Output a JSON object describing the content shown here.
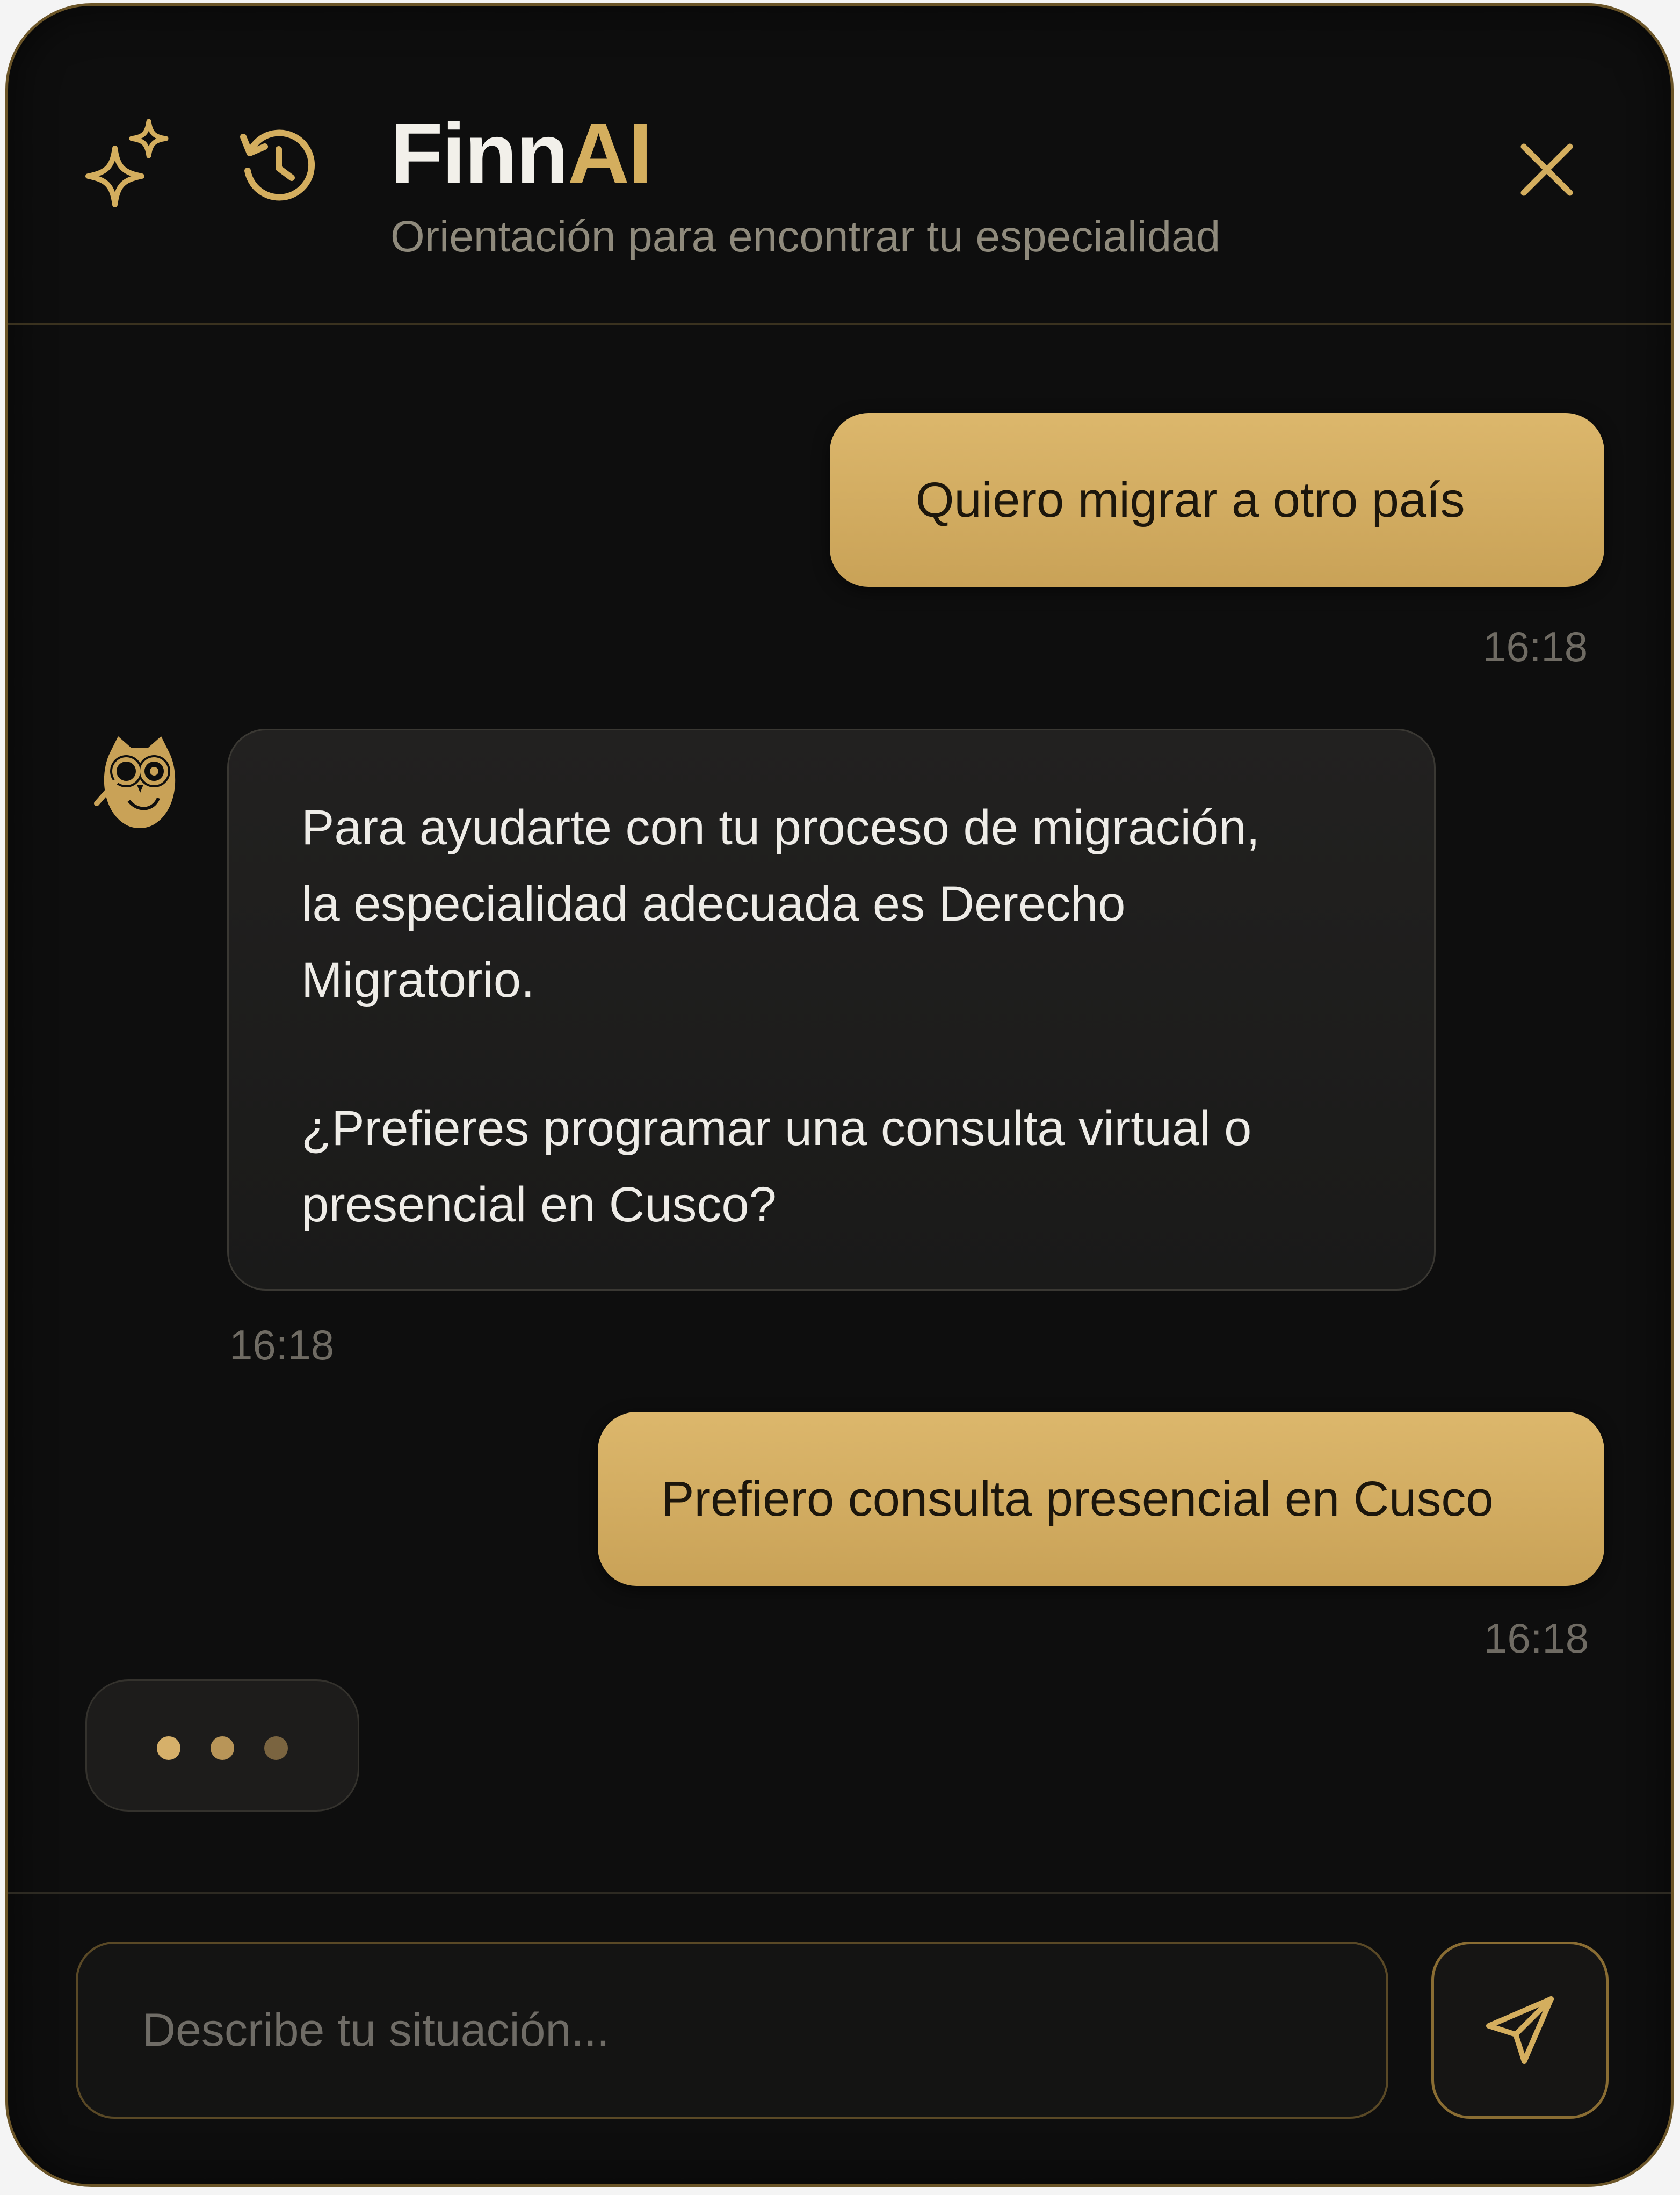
{
  "header": {
    "brand_primary": "Finn",
    "brand_accent": "AI",
    "subtitle": "Orientación para encontrar tu especialidad",
    "icons": {
      "left": "sparkle-icon",
      "history": "history-icon",
      "close": "close-icon"
    }
  },
  "messages": [
    {
      "role": "user",
      "text": "Quiero migrar a otro país",
      "time": "16:18"
    },
    {
      "role": "assistant",
      "avatar": "owl-avatar-icon",
      "lines": [
        "Para ayudarte con tu proceso de migración,",
        "la especialidad adecuada es Derecho",
        "Migratorio.",
        "",
        "¿Prefieres programar una consulta virtual o",
        "presencial en Cusco?"
      ],
      "time": "16:18"
    },
    {
      "role": "user",
      "text": "Prefiero consulta presencial en Cusco",
      "time": "16:18"
    }
  ],
  "typing_indicator": {
    "dots": 3,
    "colors": [
      "#d6b06a",
      "#b89558",
      "#7a6440"
    ]
  },
  "composer": {
    "placeholder": "Describe tu situación...",
    "send_icon": "send-icon"
  },
  "colors": {
    "accent": "#d4ae5e",
    "background": "#0e0e0e",
    "user_bubble": "#d4ae5e",
    "bot_bubble": "#1e1d1c"
  }
}
